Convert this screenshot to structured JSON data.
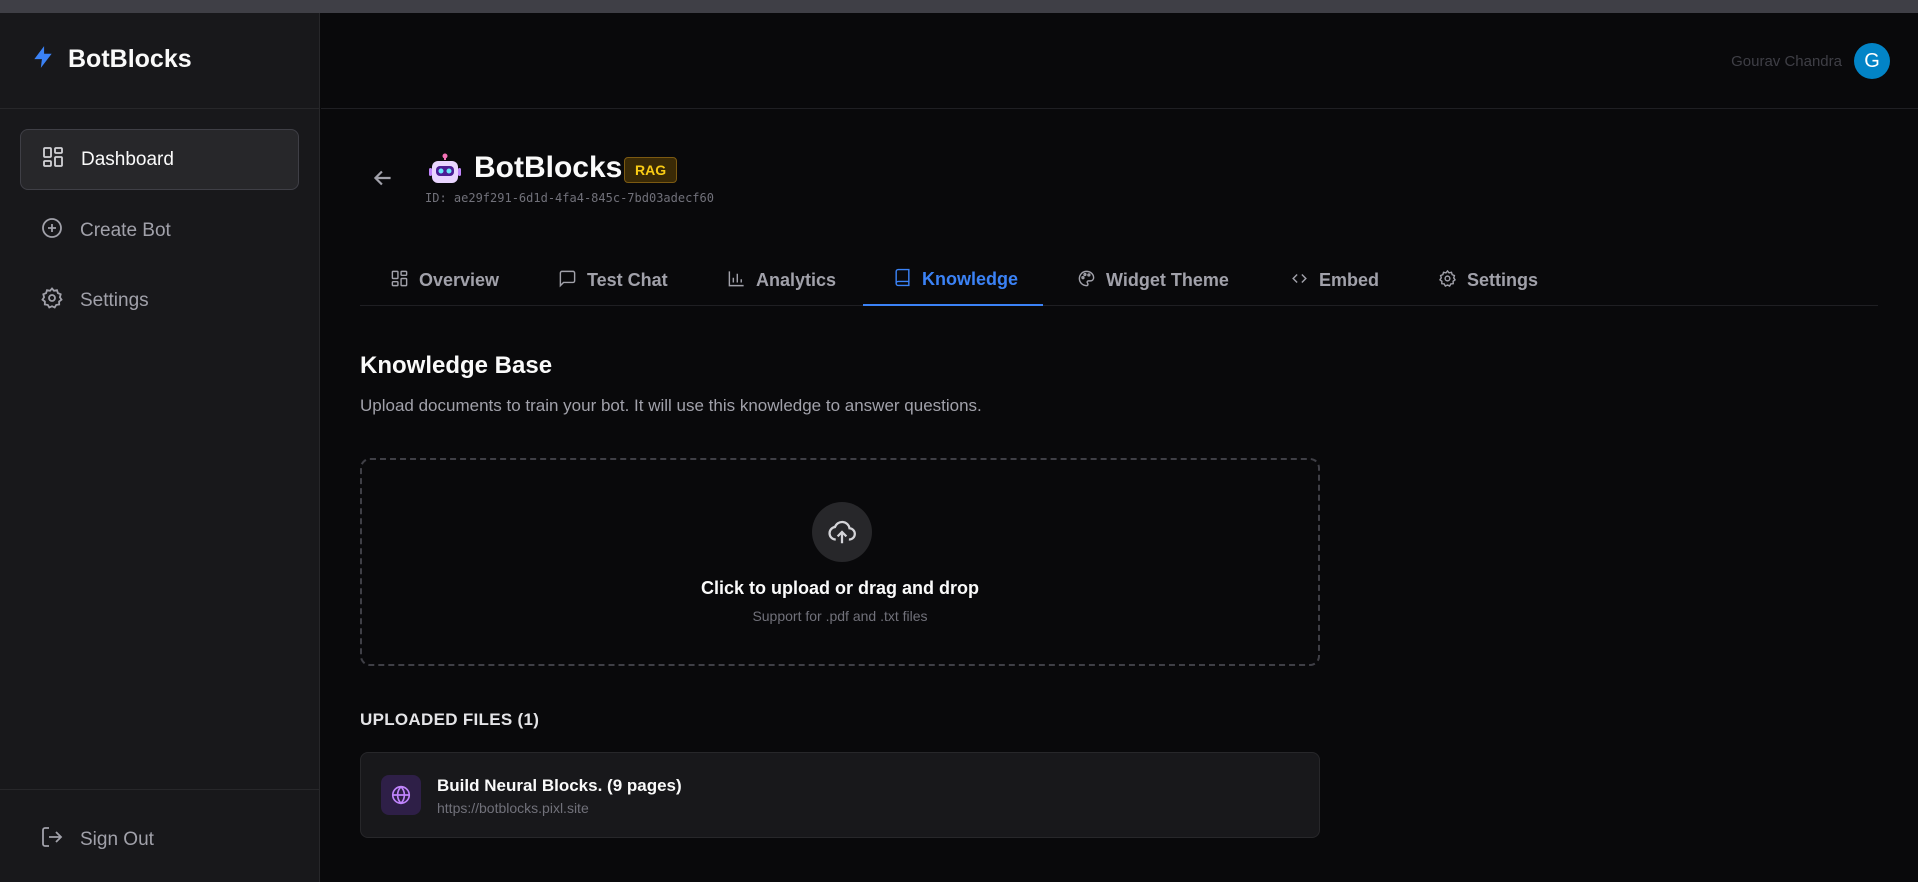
{
  "brand": {
    "name": "BotBlocks",
    "icon": "lightning-icon",
    "accent": "#3b82f6"
  },
  "sidebar": {
    "items": [
      {
        "label": "Dashboard",
        "icon": "dashboard-icon",
        "active": true
      },
      {
        "label": "Create Bot",
        "icon": "plus-circle-icon",
        "active": false
      },
      {
        "label": "Settings",
        "icon": "gear-icon",
        "active": false
      }
    ],
    "sign_out": {
      "label": "Sign Out",
      "icon": "sign-out-icon"
    }
  },
  "header": {
    "user_name": "Gourav Chandra",
    "avatar_initial": "G",
    "avatar_color": "#0284c7"
  },
  "bot": {
    "name": "BotBlocks",
    "badge": "RAG",
    "id_text": "ID: ae29f291-6d1d-4fa4-845c-7bd03adecf60",
    "icon": "robot-icon"
  },
  "tabs": [
    {
      "label": "Overview",
      "icon": "grid-icon",
      "active": false
    },
    {
      "label": "Test Chat",
      "icon": "chat-icon",
      "active": false
    },
    {
      "label": "Analytics",
      "icon": "bar-chart-icon",
      "active": false
    },
    {
      "label": "Knowledge",
      "icon": "book-icon",
      "active": true
    },
    {
      "label": "Widget Theme",
      "icon": "palette-icon",
      "active": false
    },
    {
      "label": "Embed",
      "icon": "code-icon",
      "active": false
    },
    {
      "label": "Settings",
      "icon": "gear-icon",
      "active": false
    }
  ],
  "knowledge": {
    "title": "Knowledge Base",
    "subtitle": "Upload documents to train your bot. It will use this knowledge to answer questions.",
    "upload": {
      "title": "Click to upload or drag and drop",
      "subtitle": "Support for .pdf and .txt files",
      "icon": "cloud-upload-icon"
    },
    "files_heading": "UPLOADED FILES (1)",
    "files": [
      {
        "name": "Build Neural Blocks. (9 pages)",
        "url": "https://botblocks.pixl.site",
        "icon": "globe-icon"
      }
    ]
  }
}
